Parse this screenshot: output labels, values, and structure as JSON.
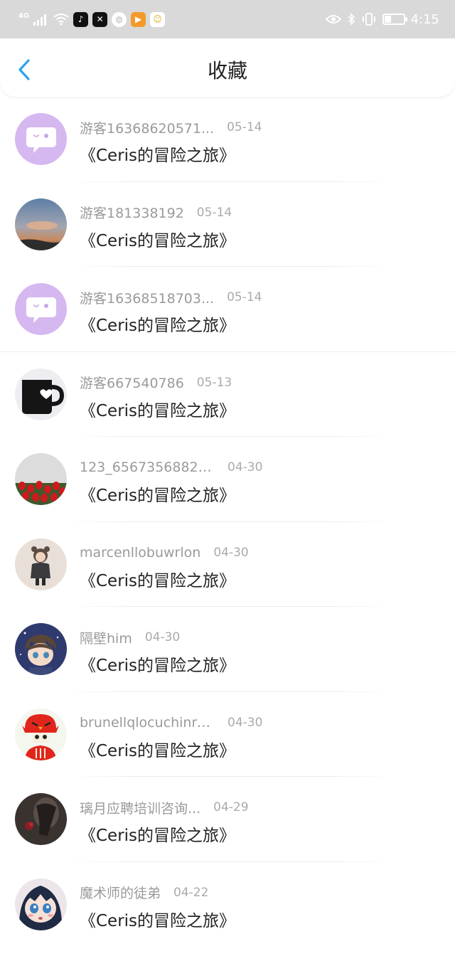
{
  "status_bar": {
    "network": "4G",
    "time": "4:15",
    "battery_level": 0.35
  },
  "header": {
    "title": "收藏"
  },
  "favorites": [
    {
      "user": "游客16368620571...",
      "date": "05-14",
      "novel": "《Ceris的冒险之旅》",
      "avatar": "chat-bubble-avatar"
    },
    {
      "user": "游客181338192",
      "date": "05-14",
      "novel": "《Ceris的冒险之旅》",
      "avatar": "sky-photo-avatar"
    },
    {
      "user": "游客16368518703...",
      "date": "05-14",
      "novel": "《Ceris的冒险之旅》",
      "avatar": "chat-bubble-avatar"
    },
    {
      "user": "游客667540786",
      "date": "05-13",
      "novel": "《Ceris的冒险之旅》",
      "avatar": "mug-photo-avatar"
    },
    {
      "user": "123_65673568829...",
      "date": "04-30",
      "novel": "《Ceris的冒险之旅》",
      "avatar": "tulips-photo-avatar"
    },
    {
      "user": "marcenllobuwrlon",
      "date": "04-30",
      "novel": "《Ceris的冒险之旅》",
      "avatar": "child-photo-avatar"
    },
    {
      "user": "隔壁him",
      "date": "04-30",
      "novel": "《Ceris的冒险之旅》",
      "avatar": "anime-boy-avatar"
    },
    {
      "user": "brunellqlocuchinre...",
      "date": "04-30",
      "novel": "《Ceris的冒险之旅》",
      "avatar": "red-bird-skeleton-avatar"
    },
    {
      "user": "璃月应聘培训咨询...",
      "date": "04-29",
      "novel": "《Ceris的冒险之旅》",
      "avatar": "dark-rose-avatar"
    },
    {
      "user": "魔术师的徒弟",
      "date": "04-22",
      "novel": "《Ceris的冒险之旅》",
      "avatar": "anime-girl-avatar"
    }
  ],
  "colors": {
    "accent": "#2ba3f0",
    "status_bar_bg": "#d9d9d9",
    "avatar_lilac": "#d6b8f0"
  }
}
